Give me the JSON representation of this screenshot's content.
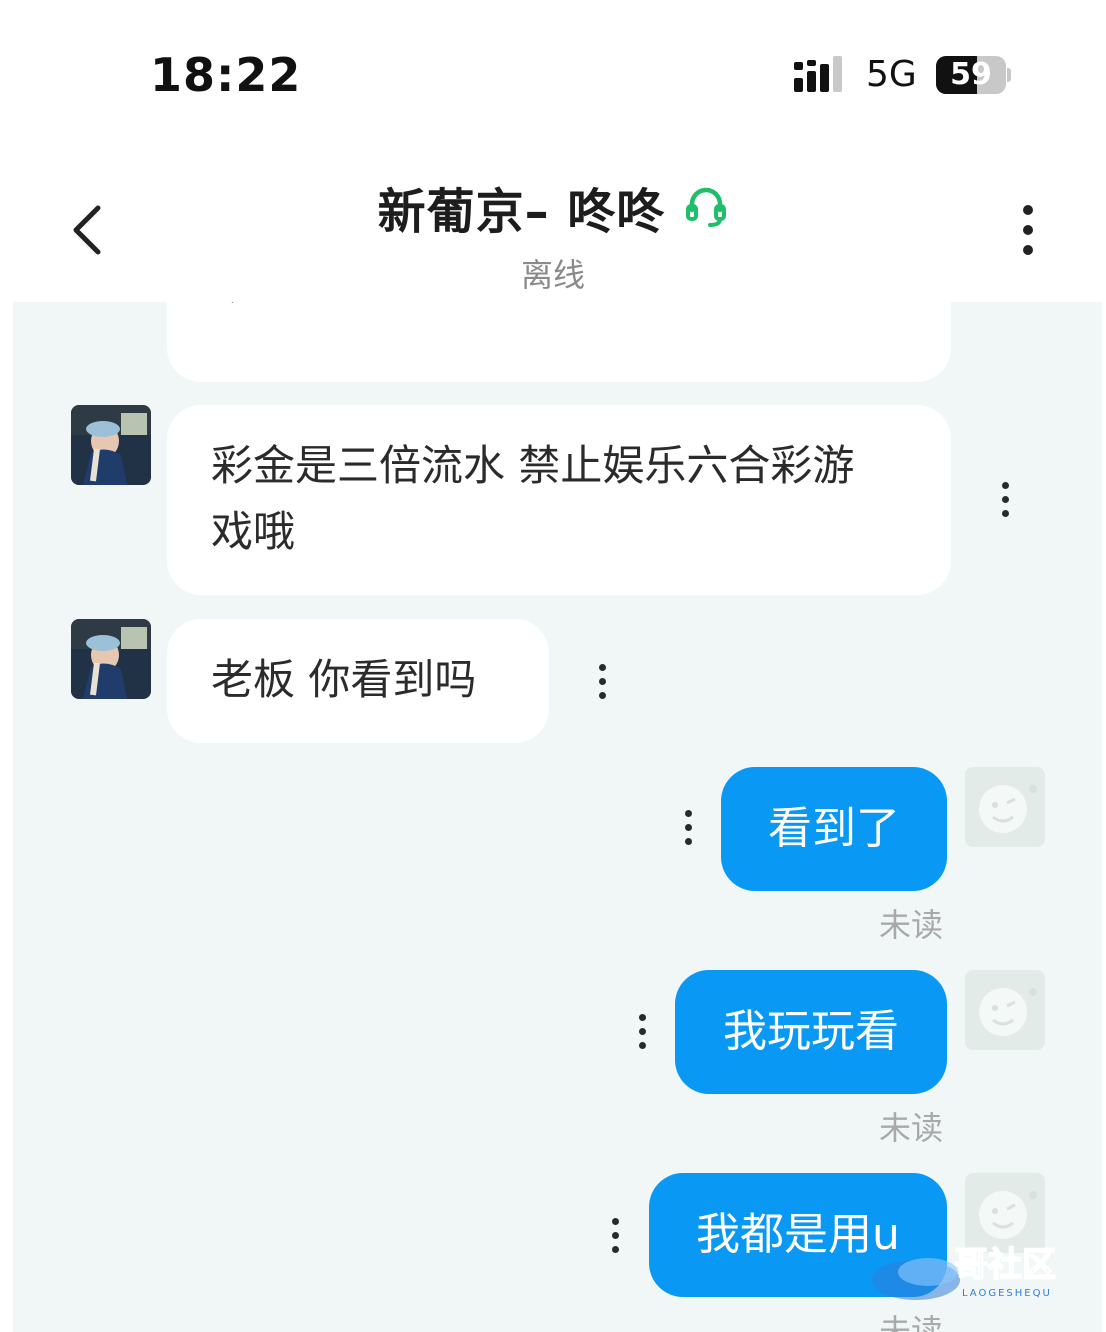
{
  "status_bar": {
    "time": "18:22",
    "network": "5G",
    "battery_level": "59",
    "battery_fraction": 0.59
  },
  "header": {
    "title": "新葡京– 咚咚",
    "status": "离线",
    "title_icon": "headset-icon",
    "back_icon": "chevron-left-icon",
    "menu_icon": "more-vertical-icon"
  },
  "messages": [
    {
      "from": "contact",
      "text": "账",
      "partial": true
    },
    {
      "from": "contact",
      "text": "彩金是三倍流水 禁止娱乐六合彩游戏哦"
    },
    {
      "from": "contact",
      "text": "老板 你看到吗"
    },
    {
      "from": "me",
      "text": "看到了",
      "read_status": "未读"
    },
    {
      "from": "me",
      "text": "我玩玩看",
      "read_status": "未读"
    },
    {
      "from": "me",
      "text": "我都是用u",
      "read_status": "未读"
    }
  ],
  "watermark": {
    "text": "哥社区",
    "subtext": "LAOGESHEQU"
  },
  "colors": {
    "my_bubble": "#0a98f5",
    "chat_bg": "#f1f7f7",
    "headset_green": "#1fbf6a",
    "muted_text": "#a9a9a9"
  }
}
